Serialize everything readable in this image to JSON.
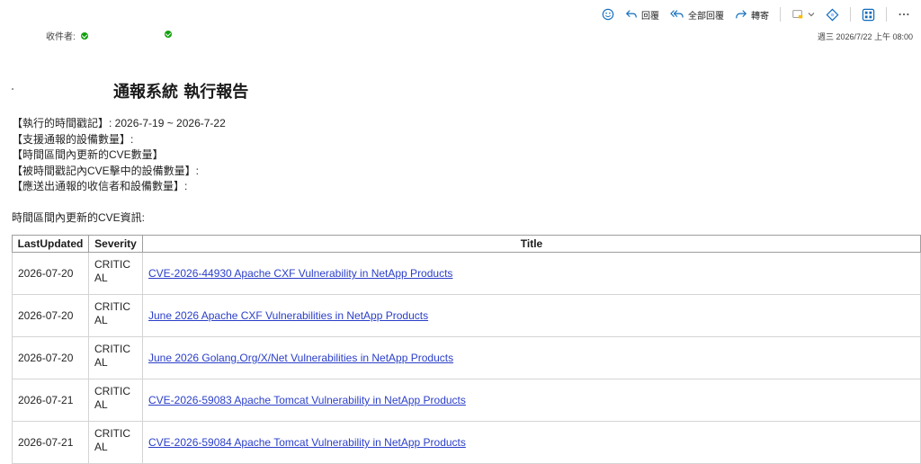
{
  "toolbar": {
    "reply_label": "回覆",
    "reply_all_label": "全部回覆",
    "forward_label": "轉寄"
  },
  "header": {
    "recipients_label": "收件者:",
    "date": "週三 2026/7/22 上午 08:00"
  },
  "email": {
    "title": "通報系統 執行報告",
    "info_lines": [
      "【執行的時間戳記】: 2026-7-19 ~ 2026-7-22",
      "【支援通報的設備數量】:",
      "【時間區間內更新的CVE數量】",
      "【被時間戳記內CVE擊中的設備數量】:",
      "【應送出通報的收信者和設備數量】:"
    ],
    "section_label": "時間區間內更新的CVE資訊:",
    "table": {
      "headers": [
        "LastUpdated",
        "Severity",
        "Title"
      ],
      "rows": [
        {
          "date": "2026-07-20",
          "severity": "CRITICAL",
          "title": "CVE-2026-44930 Apache CXF Vulnerability in NetApp Products"
        },
        {
          "date": "2026-07-20",
          "severity": "CRITICAL",
          "title": "June 2026 Apache CXF Vulnerabilities in NetApp Products"
        },
        {
          "date": "2026-07-20",
          "severity": "CRITICAL",
          "title": "June 2026 Golang.Org/X/Net Vulnerabilities in NetApp Products"
        },
        {
          "date": "2026-07-21",
          "severity": "CRITICAL",
          "title": "CVE-2026-59083 Apache Tomcat Vulnerability in NetApp Products"
        },
        {
          "date": "2026-07-21",
          "severity": "CRITICAL",
          "title": "CVE-2026-59084 Apache Tomcat Vulnerability in NetApp Products"
        }
      ]
    }
  },
  "colors": {
    "accent": "#0f6cbd",
    "link": "#2b3fc9",
    "status_green": "#13a10e"
  },
  "icons": [
    "smiley-icon",
    "reply-icon",
    "reply-all-icon",
    "forward-icon",
    "apps-icon",
    "chevron-down-icon",
    "tag-icon",
    "grid-icon",
    "more-icon",
    "check-icon"
  ]
}
